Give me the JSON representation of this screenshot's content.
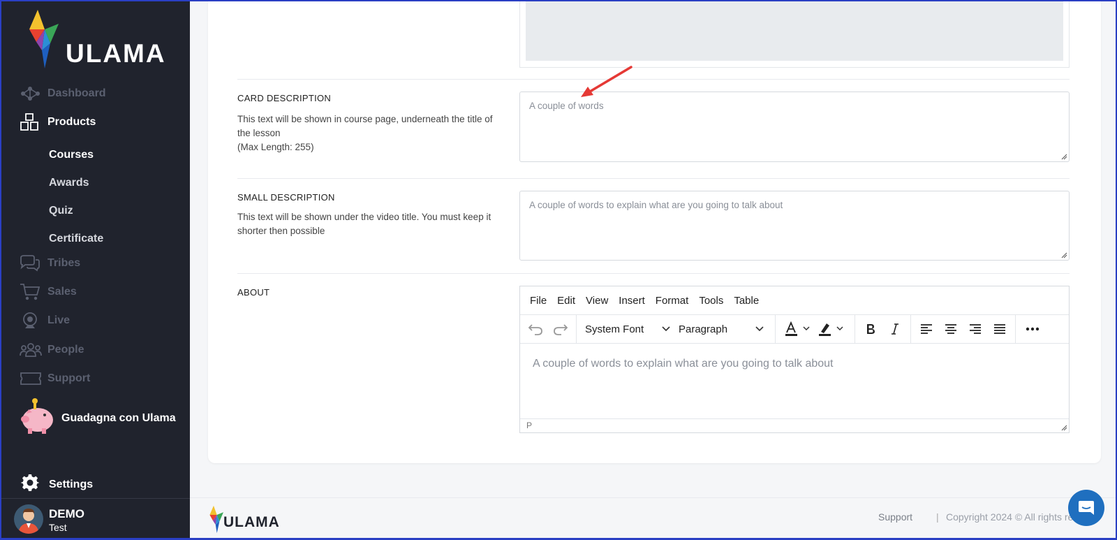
{
  "brand": {
    "name": "ULAMA"
  },
  "sidebar": {
    "items": [
      {
        "label": "Dashboard",
        "icon": "network-icon"
      },
      {
        "label": "Products",
        "icon": "boxes-icon"
      },
      {
        "label": "Tribes",
        "icon": "chat-bubbles-icon"
      },
      {
        "label": "Sales",
        "icon": "cart-icon"
      },
      {
        "label": "Live",
        "icon": "webcam-icon"
      },
      {
        "label": "People",
        "icon": "people-icon"
      },
      {
        "label": "Support",
        "icon": "ticket-icon"
      }
    ],
    "sub_items": [
      "Courses",
      "Awards",
      "Quiz",
      "Certificate"
    ],
    "earn_label": "Guadagna con Ulama",
    "settings_label": "Settings",
    "user": {
      "name": "DEMO",
      "role": "Test"
    }
  },
  "form": {
    "card_description": {
      "label": "CARD DESCRIPTION",
      "help_line1": "This text will be shown in course page, underneath the title of the lesson",
      "help_line2": "(Max Length: 255)",
      "placeholder": "A couple of words"
    },
    "small_description": {
      "label": "SMALL DESCRIPTION",
      "help": "This text will be shown under the video title. You must keep it shorter then possible",
      "placeholder": "A couple of words to explain what are you going to talk about"
    },
    "about": {
      "label": "ABOUT",
      "menu": [
        "File",
        "Edit",
        "View",
        "Insert",
        "Format",
        "Tools",
        "Table"
      ],
      "font_select": "System Font",
      "block_select": "Paragraph",
      "placeholder": "A couple of words to explain what are you going to talk about",
      "status": "P"
    }
  },
  "footer": {
    "support": "Support",
    "separator": "|",
    "copyright": "Copyright 2024 © All rights res"
  },
  "colors": {
    "sidebar_bg": "#20232d",
    "accent_arrow": "#e53935",
    "chat_button": "#1f6fbf"
  }
}
